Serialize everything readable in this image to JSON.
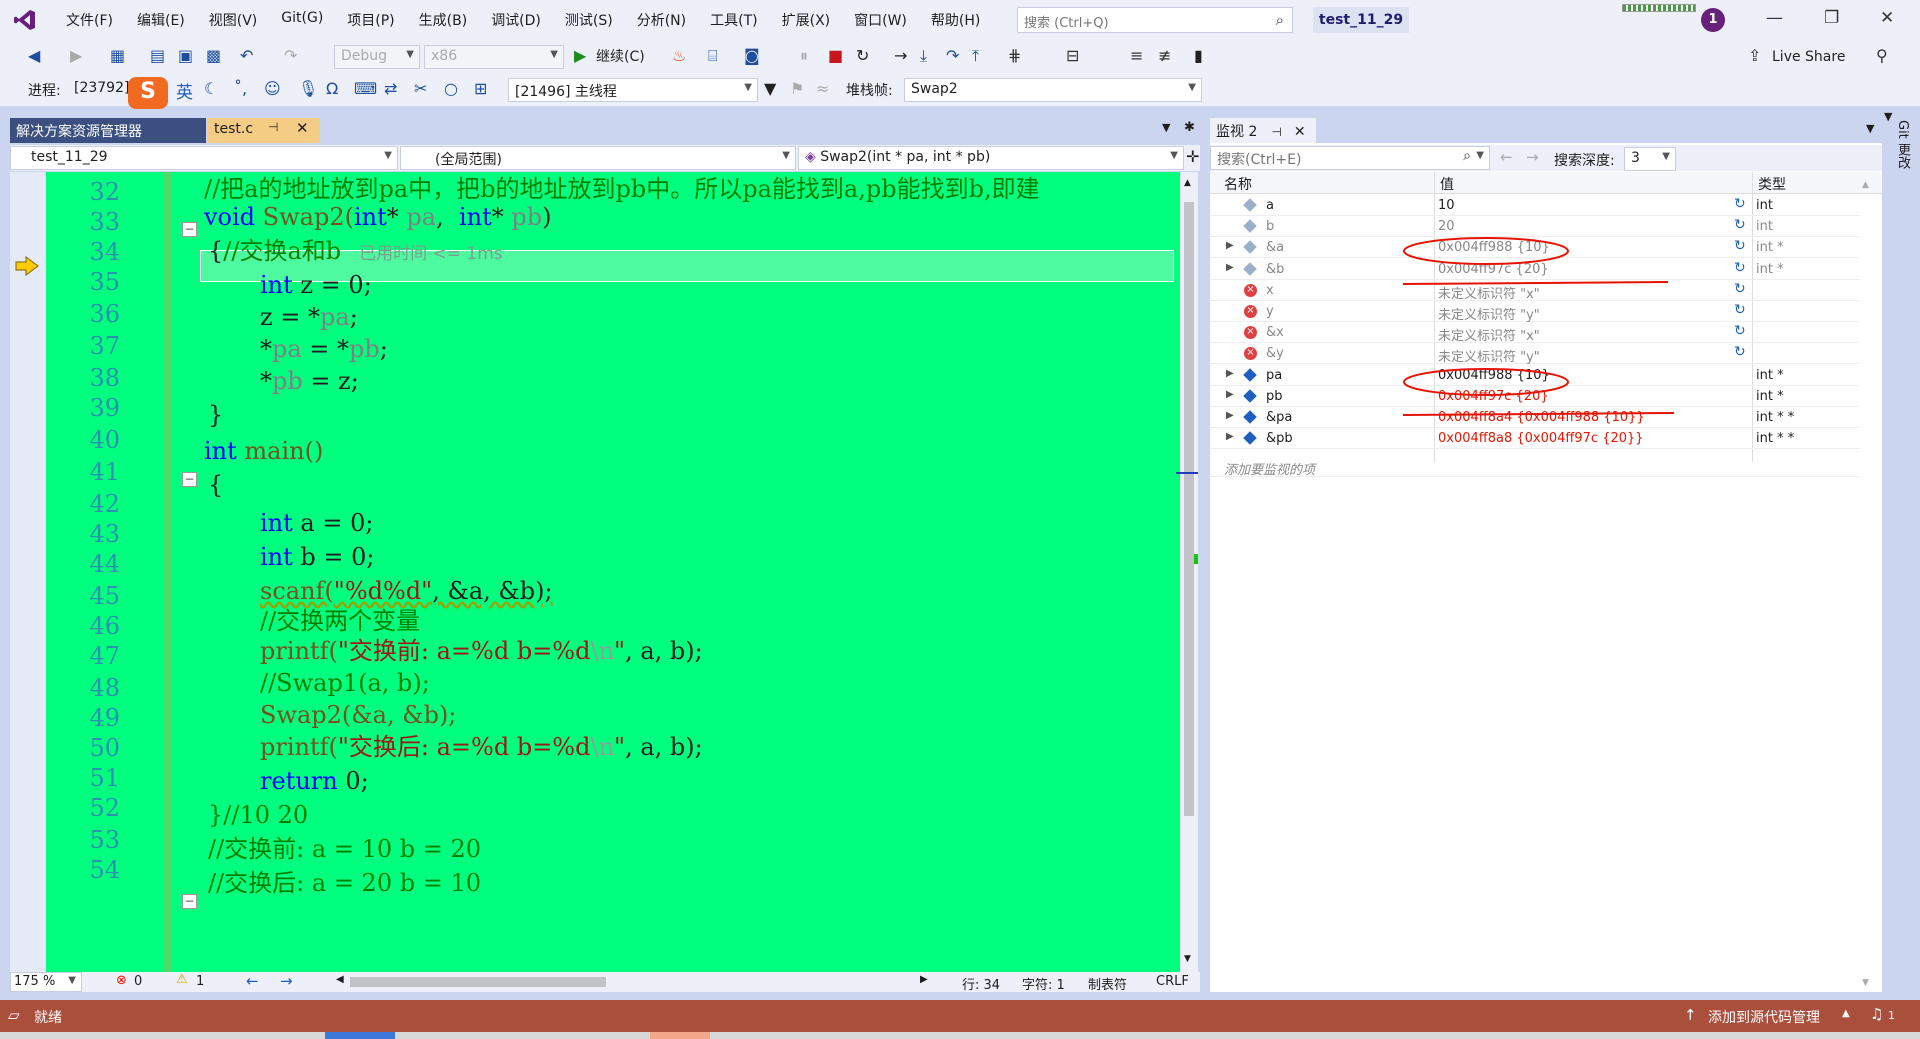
{
  "menu": {
    "items": [
      "文件(F)",
      "编辑(E)",
      "视图(V)",
      "Git(G)",
      "项目(P)",
      "生成(B)",
      "调试(D)",
      "测试(S)",
      "分析(N)",
      "工具(T)",
      "扩展(X)",
      "窗口(W)",
      "帮助(H)"
    ],
    "search_placeholder": "搜索 (Ctrl+Q)",
    "solution": "test_11_29",
    "avatar": "1"
  },
  "toolbar": {
    "config": "Debug",
    "platform": "x86",
    "continue": "继续(C)",
    "live_share": "Live Share"
  },
  "debugbar": {
    "process_label": "进程:",
    "process": "[23792]",
    "ime": "英",
    "thread": "[21496] 主线程",
    "stack_label": "堆栈帧:",
    "stack": "Swap2"
  },
  "tabs": {
    "solution_explorer": "解决方案资源管理器",
    "file": "test.c"
  },
  "nav": {
    "project": "test_11_29",
    "scope": "(全局范围)",
    "func": "Swap2(int * pa, int * pb)"
  },
  "editor": {
    "line_numbers": [
      "32",
      "33",
      "34",
      "35",
      "36",
      "37",
      "38",
      "39",
      "40",
      "41",
      "42",
      "43",
      "44",
      "45",
      "46",
      "47",
      "48",
      "49",
      "50",
      "51",
      "52",
      "53",
      "54"
    ],
    "l32": "//把a的地址放到pa中，把b的地址放到pb中。所以pa能找到a,pb能找到b,即建",
    "l33a": "void",
    "l33b": " Swap2(",
    "l33c": "int",
    "l33d": "* ",
    "l33e": "pa",
    "l33f": ",  ",
    "l33g": "int",
    "l33h": "* ",
    "l33i": "pb",
    "l33j": ")",
    "l34a": "{",
    "l34b": "//交换a和b",
    "l34c": "已用时间 <= 1ms",
    "l35a": "int",
    "l35b": " z = ",
    "l35c": "0",
    ";": ";",
    "l36a": "z = *",
    "l36b": "pa",
    "l37a": "*",
    "l37b": "pa",
    "l37c": " = *",
    "l37d": "pb",
    "l38a": "*",
    "l38b": "pb",
    "l38c": " = z",
    "l39": "}",
    "l40a": "int",
    "l40b": " main()",
    "l41": "{",
    "l42a": "int",
    "l42b": " a = ",
    "l42c": "0",
    "l43a": "int",
    "l43b": " b = ",
    "l43c": "0",
    "l44a": "scanf(",
    "l44b": "\"%d%d\"",
    "l44c": ", &a, &b);",
    "l45": "//交换两个变量",
    "l46a": "printf(",
    "l46b": "\"交换前: a=%d b=%d",
    "l46c": "\\n",
    "l46d": "\"",
    "l46e": ", a, b);",
    "l47": "//Swap1(a, b);",
    "l48": "Swap2(&a, &b);",
    "l49a": "printf(",
    "l49b": "\"交换后: a=%d b=%d",
    "l49c": "\\n",
    "l49d": "\"",
    "l49e": ", a, b);",
    "l50a": "return",
    "l50b": " 0;",
    "l51": "}//10 20",
    "l52": "//交换前: a = 10 b = 20",
    "l53": "//交换后: a = 20 b = 10",
    "semicolon": ";"
  },
  "editor_status": {
    "zoom": "175 %",
    "errors": "0",
    "warnings": "1",
    "line": "行: 34",
    "char": "字符: 1",
    "tabs": "制表符",
    "eol": "CRLF"
  },
  "watch": {
    "title": "监视 2",
    "search_placeholder": "搜索(Ctrl+E)",
    "depth_label": "搜索深度:",
    "depth": "3",
    "col_name": "名称",
    "col_value": "值",
    "col_type": "类型",
    "add": "添加要监视的项",
    "rows": [
      {
        "name": "a",
        "value": "10",
        "type": "int"
      },
      {
        "name": "b",
        "value": "20",
        "type": "int"
      },
      {
        "name": "&a",
        "value": "0x004ff988 {10}",
        "type": "int *"
      },
      {
        "name": "&b",
        "value": "0x004ff97c {20}",
        "type": "int *"
      },
      {
        "name": "x",
        "value": "未定义标识符 \"x\"",
        "type": ""
      },
      {
        "name": "y",
        "value": "未定义标识符 \"y\"",
        "type": ""
      },
      {
        "name": "&x",
        "value": "未定义标识符 \"x\"",
        "type": ""
      },
      {
        "name": "&y",
        "value": "未定义标识符 \"y\"",
        "type": ""
      },
      {
        "name": "pa",
        "value": "0x004ff988 {10}",
        "type": "int *"
      },
      {
        "name": "pb",
        "value": "0x004ff97c {20}",
        "type": "int *"
      },
      {
        "name": "&pa",
        "value": "0x004ff8a4 {0x004ff988 {10}}",
        "type": "int * *"
      },
      {
        "name": "&pb",
        "value": "0x004ff8a8 {0x004ff97c {20}}",
        "type": "int * *"
      }
    ]
  },
  "statusbar": {
    "ready": "就绪",
    "source_control": "添加到源代码管理",
    "notif": "1"
  },
  "side": {
    "git": "Git 更改"
  }
}
